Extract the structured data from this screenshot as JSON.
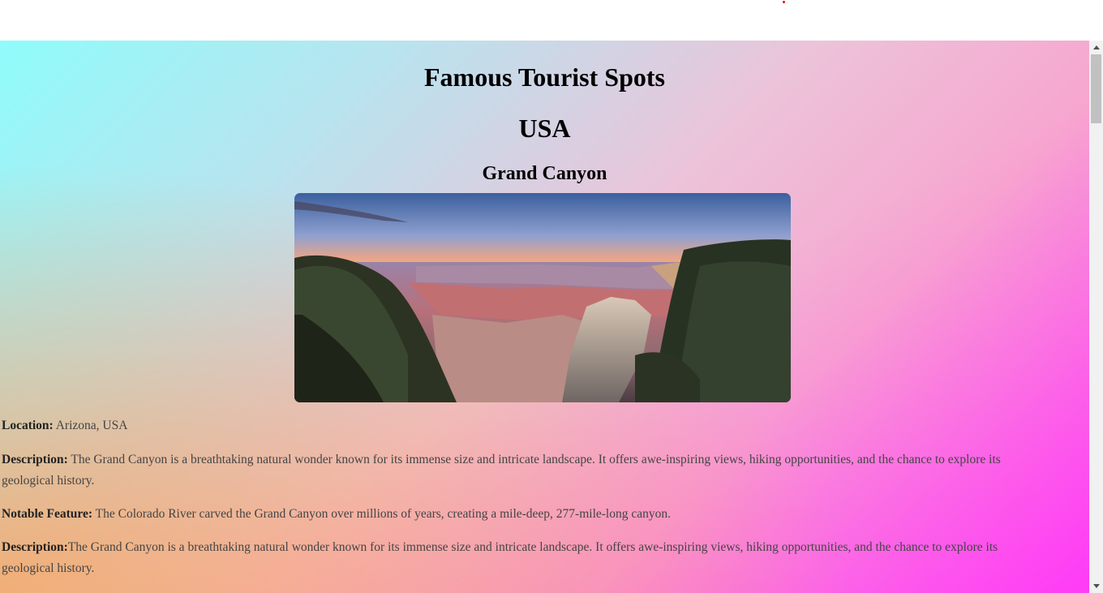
{
  "page": {
    "title": "Famous Tourist Spots",
    "country": "USA"
  },
  "spot": {
    "name": "Grand Canyon",
    "image_alt": "Grand Canyon",
    "location_label": "Location:",
    "location_value": " Arizona, USA",
    "description_label": "Description:",
    "description_value": " The Grand Canyon is a breathtaking natural wonder known for its immense size and intricate landscape. It offers awe-inspiring views, hiking opportunities, and the chance to explore its geological history.",
    "feature_label": "Notable Feature:",
    "feature_value": " The Colorado River carved the Grand Canyon over millions of years, creating a mile-deep, 277-mile-long canyon.",
    "description2_label": "Description:",
    "description2_value": "The Grand Canyon is a breathtaking natural wonder known for its immense size and intricate landscape. It offers awe-inspiring views, hiking opportunities, and the chance to explore its geological history."
  },
  "colors": {
    "gradient_top": "#8ffcfb",
    "gradient_bottom_left": "#ffa24f",
    "gradient_bottom_right": "#ff36f5"
  },
  "icons": {
    "scroll_up": "triangle-up",
    "scroll_down": "triangle-down"
  }
}
